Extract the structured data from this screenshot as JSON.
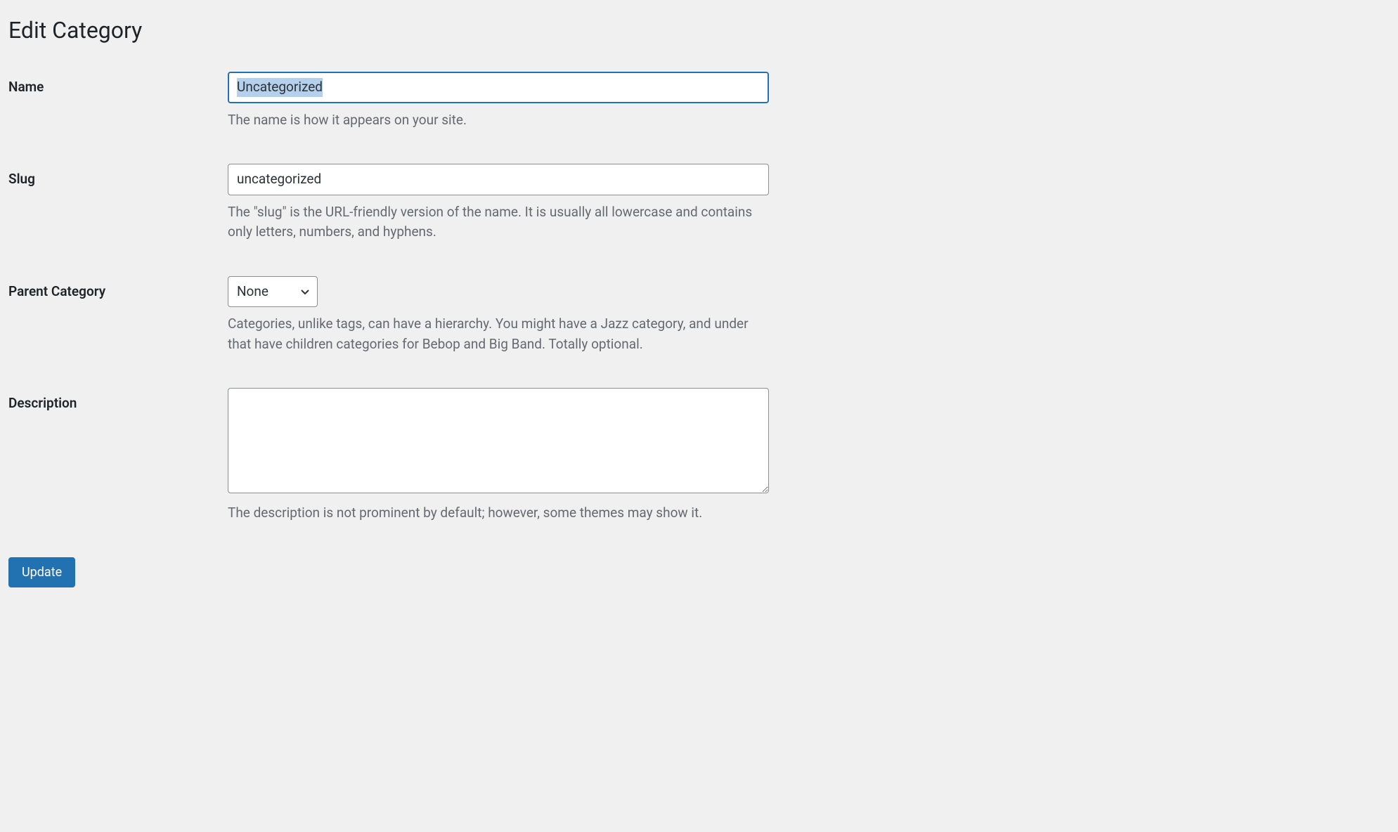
{
  "page_title": "Edit Category",
  "fields": {
    "name": {
      "label": "Name",
      "value": "Uncategorized",
      "description": "The name is how it appears on your site."
    },
    "slug": {
      "label": "Slug",
      "value": "uncategorized",
      "description": "The \"slug\" is the URL-friendly version of the name. It is usually all lowercase and contains only letters, numbers, and hyphens."
    },
    "parent": {
      "label": "Parent Category",
      "value": "None",
      "description": "Categories, unlike tags, can have a hierarchy. You might have a Jazz category, and under that have children categories for Bebop and Big Band. Totally optional."
    },
    "description": {
      "label": "Description",
      "value": "",
      "description": "The description is not prominent by default; however, some themes may show it."
    }
  },
  "submit_label": "Update"
}
